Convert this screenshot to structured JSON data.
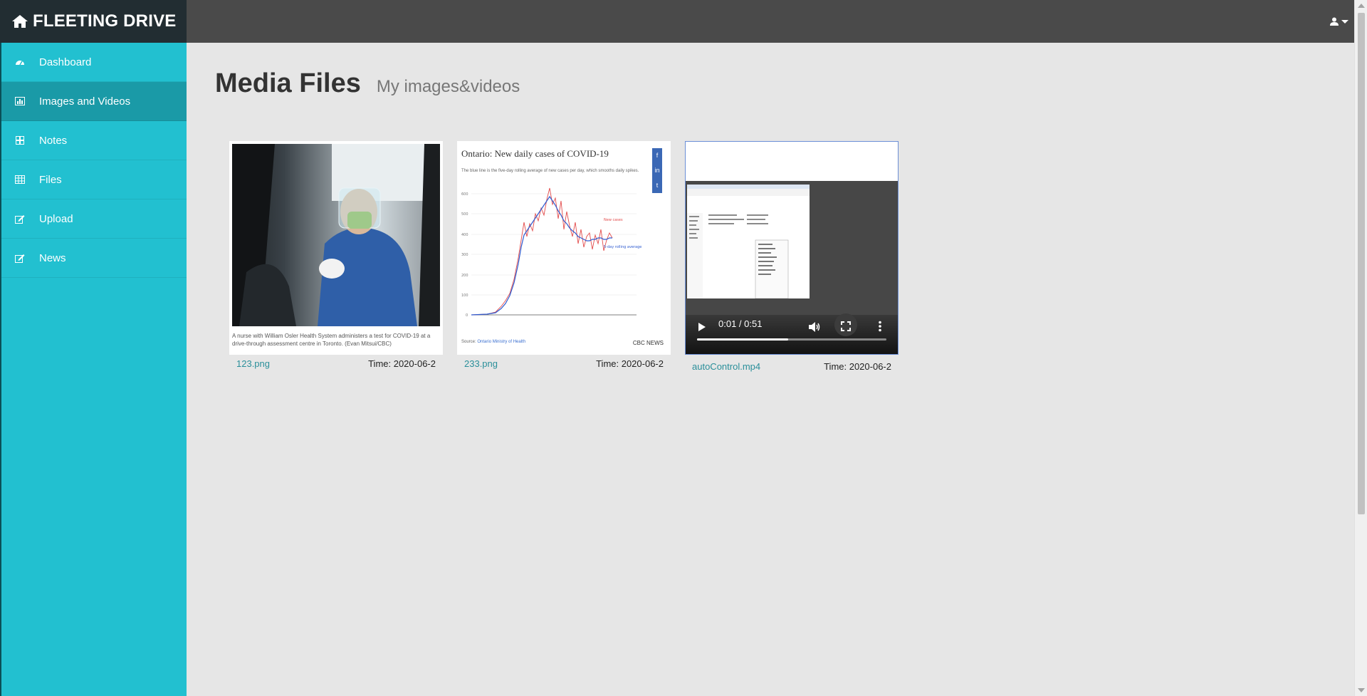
{
  "app": {
    "brand": "FLEETING DRIVE"
  },
  "sidebar": {
    "items": [
      {
        "label": "Dashboard",
        "icon": "dashboard-icon",
        "active": false
      },
      {
        "label": "Images and Videos",
        "icon": "bar-chart-icon",
        "active": true
      },
      {
        "label": "Notes",
        "icon": "notes-icon",
        "active": false
      },
      {
        "label": "Files",
        "icon": "table-icon",
        "active": false
      },
      {
        "label": "Upload",
        "icon": "edit-icon",
        "active": false
      },
      {
        "label": "News",
        "icon": "edit-icon",
        "active": false
      }
    ]
  },
  "header": {
    "title": "Media Files",
    "subtitle": "My images&videos"
  },
  "media": [
    {
      "filename": "123.png",
      "time": "Time: 2020-06-2",
      "image_caption": "A nurse with William Osler Health System administers a test for COVID-19 at a drive-through assessment centre in Toronto. (Evan Mitsui/CBC)"
    },
    {
      "filename": "233.png",
      "time": "Time: 2020-06-2",
      "image_title": "Ontario: New daily cases of COVID-19",
      "image_subtitle": "The blue line is the five-day rolling average of new cases per day, which smooths daily spikes.",
      "image_source_label": "Source:",
      "image_source": "Ontario Ministry of Health",
      "image_logo": "CBC NEWS",
      "legend_new_cases": "New cases",
      "legend_avg": "5-day rolling average"
    },
    {
      "filename": "autoControl.mp4",
      "time": "Time: 2020-06-2",
      "video_time": "0:01 / 0:51",
      "progress_fraction": 0.48
    }
  ],
  "colors": {
    "sidebar": "#22c0d0",
    "sidebar_active": "#1a9aa7",
    "topbar": "#4a4a4a",
    "brand_bg": "#222d32"
  }
}
